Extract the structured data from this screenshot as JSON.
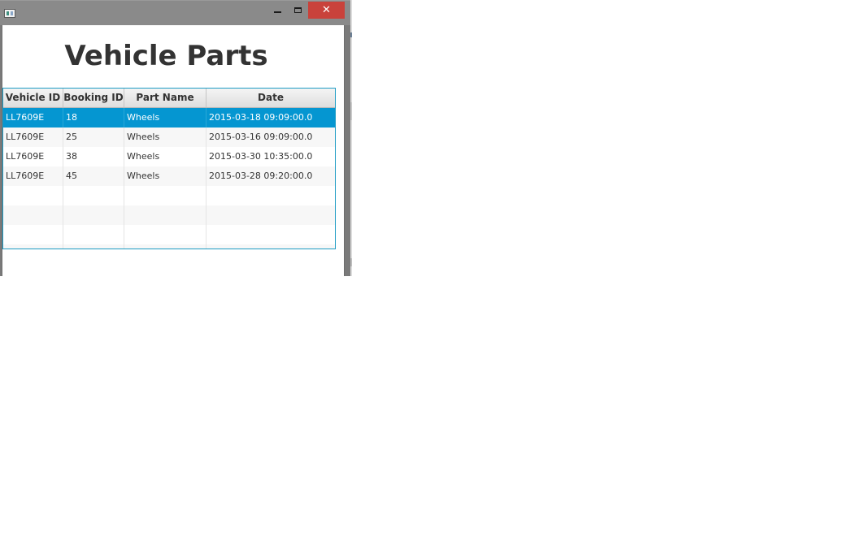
{
  "window": {
    "title": "",
    "minimize_label": "",
    "maximize_label": "",
    "close_label": "✕"
  },
  "page": {
    "title": "Vehicle Parts"
  },
  "table": {
    "columns": [
      "Vehicle ID",
      "Booking ID",
      "Part Name",
      "Date"
    ],
    "rows": [
      {
        "vehicle_id": "LL7609E",
        "booking_id": "18",
        "part_name": "Wheels",
        "date": "2015-03-18 09:09:00.0",
        "selected": true
      },
      {
        "vehicle_id": "LL7609E",
        "booking_id": "25",
        "part_name": "Wheels",
        "date": "2015-03-16 09:09:00.0",
        "selected": false
      },
      {
        "vehicle_id": "LL7609E",
        "booking_id": "38",
        "part_name": "Wheels",
        "date": "2015-03-30 10:35:00.0",
        "selected": false
      },
      {
        "vehicle_id": "LL7609E",
        "booking_id": "45",
        "part_name": "Wheels",
        "date": "2015-03-28 09:20:00.0",
        "selected": false
      }
    ],
    "empty_rows": 4
  },
  "colors": {
    "selection": "#0596d1",
    "table_border": "#1e9cc4",
    "close_button": "#c9423b"
  },
  "icons": {
    "app": "app-window-icon",
    "minimize": "minimize-icon",
    "maximize": "maximize-icon",
    "close": "close-icon"
  }
}
